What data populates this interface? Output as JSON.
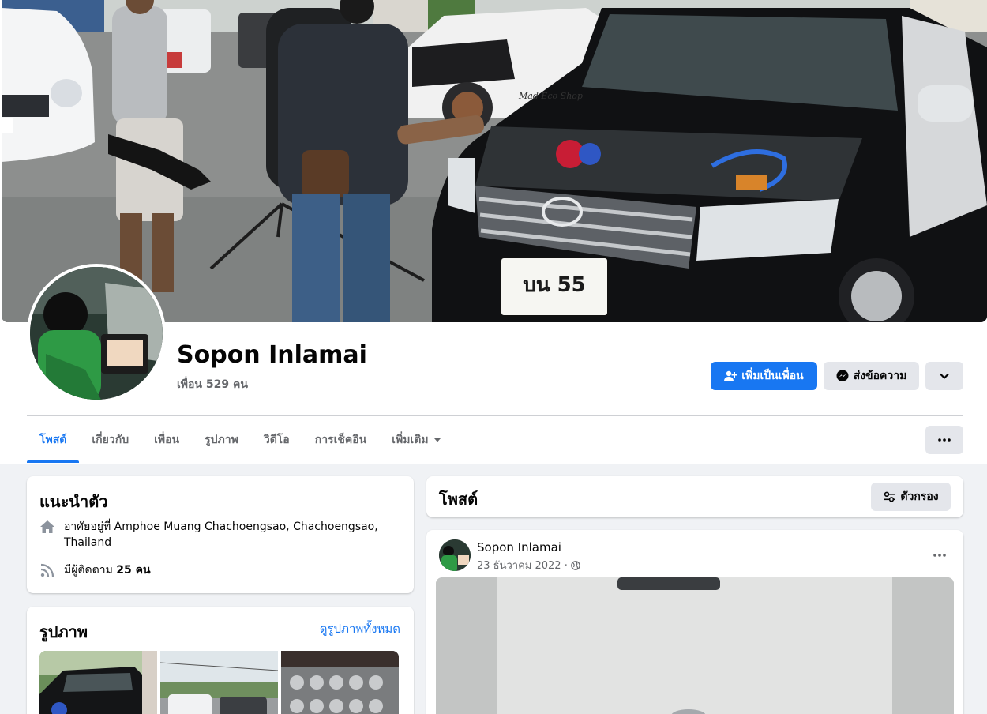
{
  "profile": {
    "name": "Sopon Inlamai",
    "friend_count": "เพื่อน 529 คน"
  },
  "actions": {
    "add_friend": "เพิ่มเป็นเพื่อน",
    "message": "ส่งข้อความ"
  },
  "tabs": [
    {
      "label": "โพสต์"
    },
    {
      "label": "เกี่ยวกับ"
    },
    {
      "label": "เพื่อน"
    },
    {
      "label": "รูปภาพ"
    },
    {
      "label": "วิดีโอ"
    },
    {
      "label": "การเช็คอิน"
    },
    {
      "label": "เพิ่มเติม"
    }
  ],
  "intro": {
    "title": "แนะนำตัว",
    "lives_in_prefix": "อาศัยอยู่ที่",
    "lives_in": "Amphoe Muang Chachoengsao, Chachoengsao, Thailand",
    "followers_prefix": "มีผู้ติดตาม",
    "followers_value": "25 คน"
  },
  "photos": {
    "title": "รูปภาพ",
    "see_all": "ดูรูปภาพทั้งหมด"
  },
  "posts": {
    "title": "โพสต์",
    "filter_label": "ตัวกรอง"
  },
  "post": {
    "author": "Sopon Inlamai",
    "date": "23 ธันวาคม 2022 ·"
  },
  "cover_photo": {
    "plate_text": "บน 55",
    "shop_text": "Mad Eco Shop"
  },
  "icons": {
    "add_friend": "person-add-icon",
    "message": "messenger-icon",
    "dropdown": "chevron-down-icon",
    "more": "more-dots-icon",
    "home": "home-icon",
    "followers": "rss-icon",
    "filter": "sliders-icon",
    "privacy": "globe-icon"
  },
  "colors": {
    "accent": "#1877f2",
    "background": "#f0f2f5",
    "secondary_button": "#e4e6eb",
    "muted_text": "#65676b"
  }
}
